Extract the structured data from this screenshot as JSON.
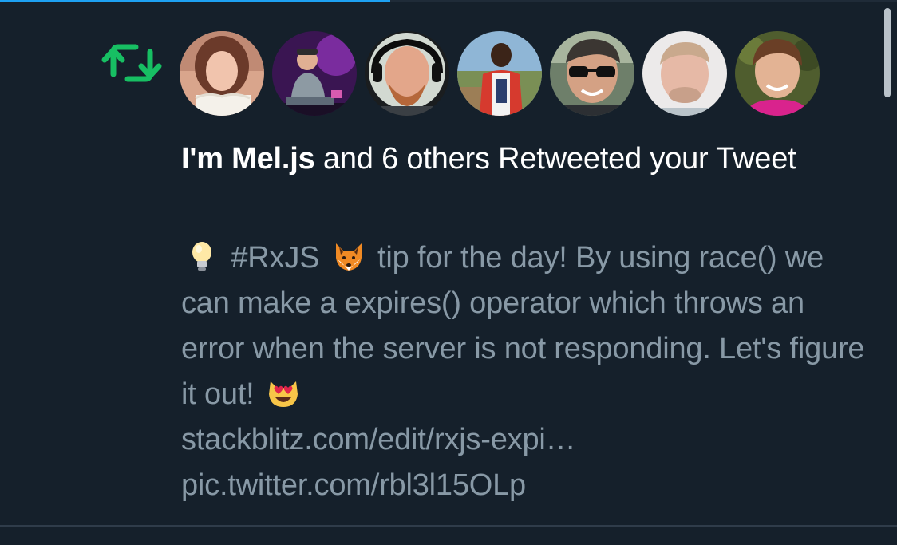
{
  "progress": {
    "fraction": 0.435,
    "color": "#1da1f2"
  },
  "notification": {
    "icon": "retweet-icon",
    "icon_color": "#17bf63",
    "avatars": [
      {
        "name": "avatar-1"
      },
      {
        "name": "avatar-2"
      },
      {
        "name": "avatar-3"
      },
      {
        "name": "avatar-4"
      },
      {
        "name": "avatar-5"
      },
      {
        "name": "avatar-6"
      },
      {
        "name": "avatar-7"
      }
    ],
    "headline": {
      "name": "I'm Mel.js",
      "rest": " and 6 others Retweeted your Tweet"
    },
    "tweet": {
      "emoji_bulb": "💡",
      "hashtag": "#RxJS",
      "emoji_fox": "🦊",
      "text_part1": "tip for the day! By using race() we can make a expires() operator which throws an error when the server is not responding. Let's figure it out!",
      "emoji_heart_eyes_cat": "😻",
      "link": "stackblitz.com/edit/rxjs-expi…",
      "pic_link": "pic.twitter.com/rbl3l15OLp"
    }
  },
  "colors": {
    "background": "#15202b",
    "headline_text": "#ffffff",
    "tweet_text": "#8899a6",
    "divider": "#2f3c4a"
  }
}
